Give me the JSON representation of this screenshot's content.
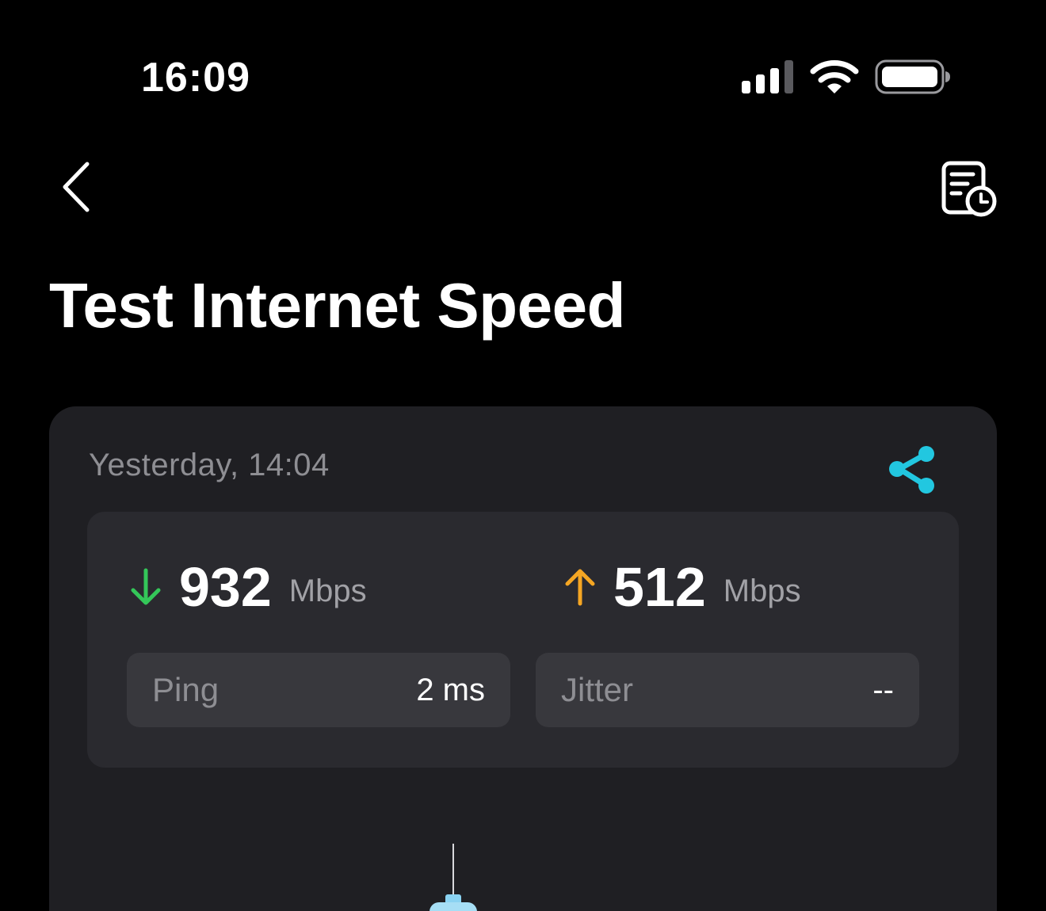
{
  "status_bar": {
    "time": "16:09"
  },
  "icons": {
    "back": "chevron-left-icon",
    "history": "history-report-icon",
    "share": "share-icon",
    "download": "arrow-down-icon",
    "upload": "arrow-up-icon",
    "signal": "cellular-signal-icon",
    "wifi": "wifi-icon",
    "battery": "battery-icon"
  },
  "header": {
    "title": "Test Internet Speed"
  },
  "result": {
    "date": "Yesterday, 14:04",
    "download": {
      "value": "932",
      "unit": "Mbps"
    },
    "upload": {
      "value": "512",
      "unit": "Mbps"
    },
    "ping": {
      "label": "Ping",
      "value": "2 ms"
    },
    "jitter": {
      "label": "Jitter",
      "value": "--"
    }
  },
  "colors": {
    "background": "#000000",
    "card": "#1f1f23",
    "panel": "#2a2a2f",
    "metric_box": "#38383d",
    "accent_share": "#22c7e0",
    "download_arrow": "#34c759",
    "upload_arrow": "#f5a623",
    "muted_text": "#8e8e93"
  }
}
